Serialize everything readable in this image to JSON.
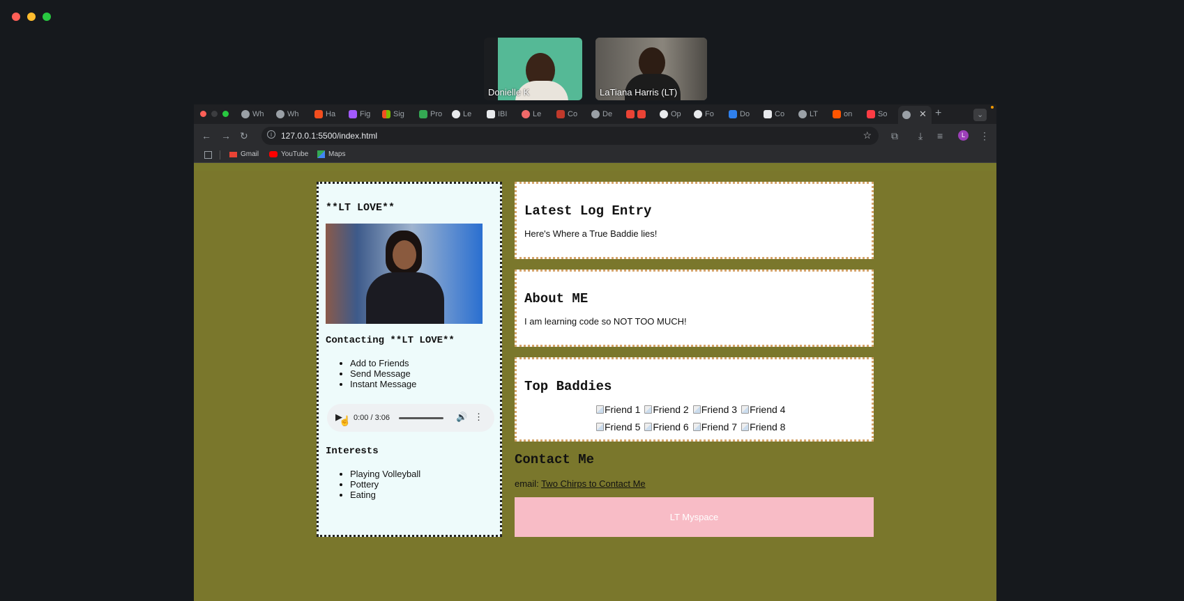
{
  "call": {
    "participants": [
      {
        "name": "Donielle K"
      },
      {
        "name": "LaTiana Harris (LT)"
      }
    ]
  },
  "browser": {
    "tabs": [
      "Wh",
      "Wh",
      "Ha",
      "Fig",
      "Sig",
      "Pro",
      "Le",
      "IBI",
      "Le",
      "Co",
      "De",
      "Op",
      "Fo",
      "Do",
      "Co",
      "LT",
      "on",
      "So"
    ],
    "url": "127.0.0.1:5500/index.html",
    "profile_initial": "L",
    "bookmarks": [
      "Gmail",
      "YouTube",
      "Maps"
    ],
    "colors": {
      "tabstrip": "#1f2023",
      "toolbar": "#2b2c2f"
    }
  },
  "page": {
    "profile": {
      "title": "**LT LOVE**",
      "contacting_heading": "Contacting **LT LOVE**",
      "contact_links": [
        "Add to Friends",
        "Send Message",
        "Instant Message"
      ],
      "audio_time": "0:00 / 3:06",
      "interests_heading": "Interests",
      "interests": [
        "Playing Volleyball",
        "Pottery",
        "Eating"
      ]
    },
    "latest": {
      "heading": "Latest Log Entry",
      "text": "Here's Where a True Baddie lies!"
    },
    "about": {
      "heading": "About ME",
      "text": "I am learning code so NOT TOO MUCH!"
    },
    "baddies": {
      "heading": "Top Baddies",
      "friends": [
        "Friend 1",
        "Friend 2",
        "Friend 3",
        "Friend 4",
        "Friend 5",
        "Friend 6",
        "Friend 7",
        "Friend 8"
      ]
    },
    "contact": {
      "heading": "Contact Me",
      "email_label": "email:",
      "email_link": "Two Chirps to Contact Me"
    },
    "footer": {
      "text": "LT Myspace"
    },
    "colors": {
      "background": "#7a772c",
      "footer": "#f8bcc6",
      "left_card": "#eefbfb",
      "card_border": "#d5a36a"
    }
  }
}
